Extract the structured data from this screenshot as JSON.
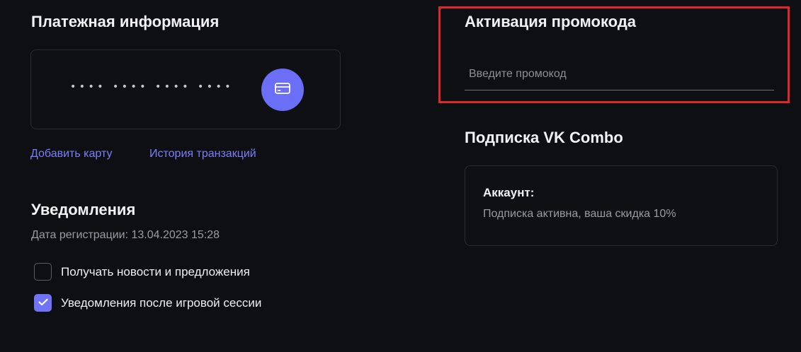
{
  "payment": {
    "title": "Платежная информация",
    "card_mask": "•••• •••• •••• ••••",
    "card_button_icon": "credit-card-icon",
    "add_card_label": "Добавить карту",
    "transactions_label": "История транзакций"
  },
  "notifications": {
    "title": "Уведомления",
    "registration_date": "Дата регистрации: 13.04.2023 15:28",
    "options": [
      {
        "label": "Получать новости и предложения",
        "checked": false
      },
      {
        "label": "Уведомления после игровой сессии",
        "checked": true
      }
    ]
  },
  "promo": {
    "title": "Активация промокода",
    "placeholder": "Введите промокод",
    "value": ""
  },
  "subscription": {
    "title": "Подписка VK Combo",
    "account_label": "Аккаунт:",
    "status_text": "Подписка активна, ваша скидка 10%"
  },
  "colors": {
    "background": "#0e0f12",
    "accent": "#6b6ef7",
    "link": "#7b7ef8",
    "highlight_frame": "#e0262b"
  }
}
